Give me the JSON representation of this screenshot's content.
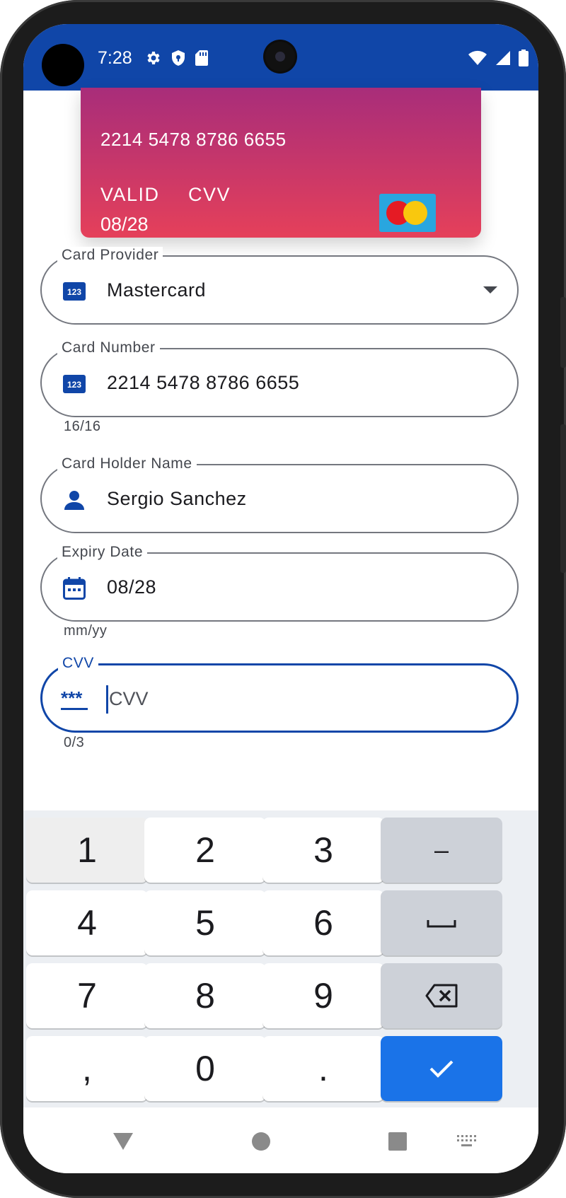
{
  "status_bar": {
    "time": "7:28",
    "icons_left": [
      "settings-icon",
      "shield-icon",
      "sd-card-icon"
    ],
    "icons_right": [
      "wifi-icon",
      "signal-icon",
      "battery-icon"
    ],
    "background": "#1046a8"
  },
  "card_preview": {
    "number": "2214 5478 8786 6655",
    "valid_label": "VALID",
    "cvv_label": "CVV",
    "expiry": "08/28",
    "brand_logo": "mastercard-logo",
    "gradient": [
      "#a82d7a",
      "#e5405a"
    ]
  },
  "form": {
    "card_provider": {
      "label": "Card Provider",
      "value": "Mastercard",
      "icon": "numbers-icon"
    },
    "card_number": {
      "label": "Card Number",
      "value": "2214 5478 8786 6655",
      "helper": "16/16",
      "icon": "numbers-icon"
    },
    "card_holder": {
      "label": "Card Holder Name",
      "value": "Sergio Sanchez",
      "icon": "person-icon"
    },
    "expiry_date": {
      "label": "Expiry Date",
      "value": "08/28",
      "helper": "mm/yy",
      "icon": "calendar-icon"
    },
    "cvv": {
      "label": "CVV",
      "placeholder": "CVV",
      "helper": "0/3",
      "icon": "password-icon",
      "icon_text": "***"
    }
  },
  "keyboard": {
    "rows": [
      [
        "1",
        "2",
        "3",
        "–"
      ],
      [
        "4",
        "5",
        "6",
        "␣"
      ],
      [
        "7",
        "8",
        "9",
        "⌫"
      ],
      [
        ",",
        "0",
        ".",
        "✓"
      ]
    ],
    "accent": "#1a73e8"
  },
  "nav_bar": {
    "buttons": [
      "back-icon",
      "home-icon",
      "recents-icon",
      "keyboard-switch-icon"
    ]
  }
}
